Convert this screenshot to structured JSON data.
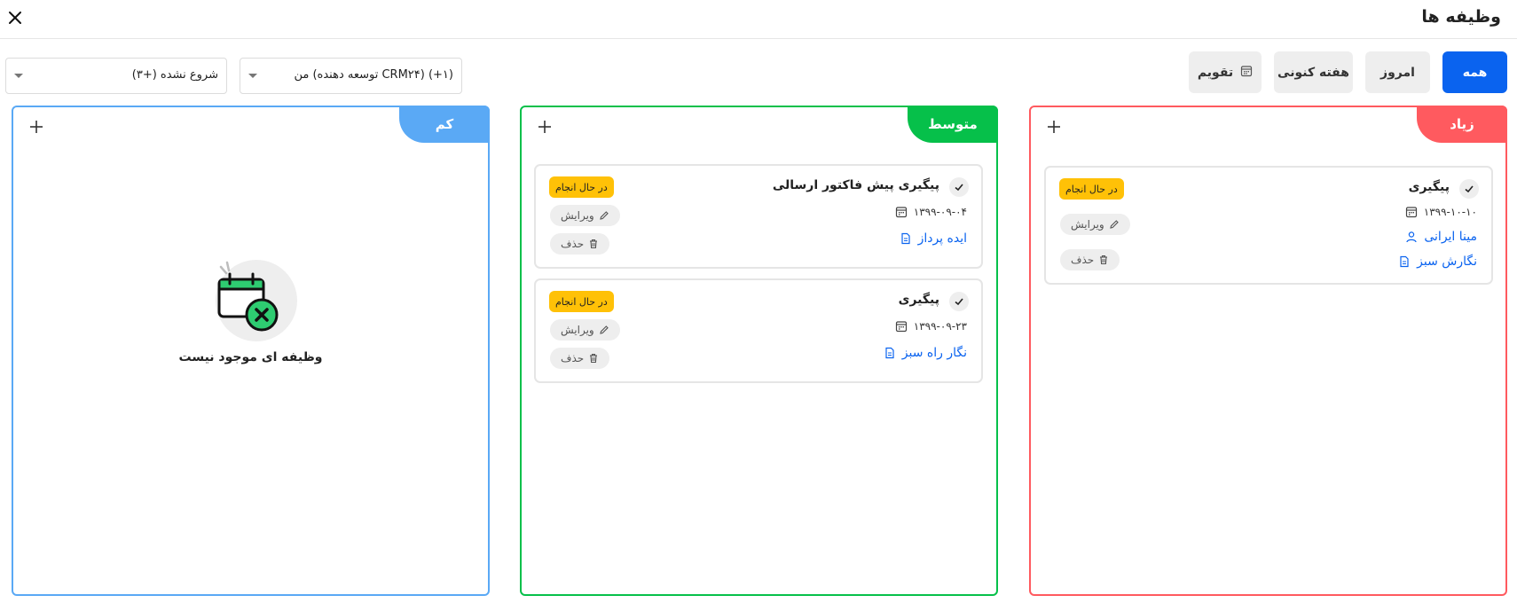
{
  "header": {
    "title": "وظیفه ها",
    "close_icon": "close-icon"
  },
  "filters": {
    "all": "همه",
    "today": "امروز",
    "this_week": "هفته کنونی",
    "calendar": "تقویم"
  },
  "dropdowns": {
    "assignee": "من (توسعه دهنده CRM۲۴) (+۱)",
    "status": "شروع نشده (+۳)"
  },
  "colors": {
    "high": "#ff5a5f",
    "medium": "#06c04a",
    "low": "#5aa9f5",
    "accent": "#0a63ef",
    "status_in_progress": "#ffc107"
  },
  "columns": {
    "high": {
      "label": "زیاد",
      "tasks": [
        {
          "title": "پیگیری",
          "date": "۱۳۹۹-۱۰-۱۰",
          "status": "در حال انجام",
          "contact": "مینا ایرانی",
          "company": "نگارش سبز",
          "edit": "ویرایش",
          "delete": "حذف"
        }
      ]
    },
    "medium": {
      "label": "متوسط",
      "tasks": [
        {
          "title": "پیگیری پیش فاکتور ارسالی",
          "date": "۱۳۹۹-۰۹-۰۴",
          "status": "در حال انجام",
          "company": "ایده پرداز",
          "edit": "ویرایش",
          "delete": "حذف"
        },
        {
          "title": "پیگیری",
          "date": "۱۳۹۹-۰۹-۲۳",
          "status": "در حال انجام",
          "company": "نگار راه سبز",
          "edit": "ویرایش",
          "delete": "حذف"
        }
      ]
    },
    "low": {
      "label": "کم",
      "empty_message": "وظیفه ای موجود نیست"
    }
  }
}
